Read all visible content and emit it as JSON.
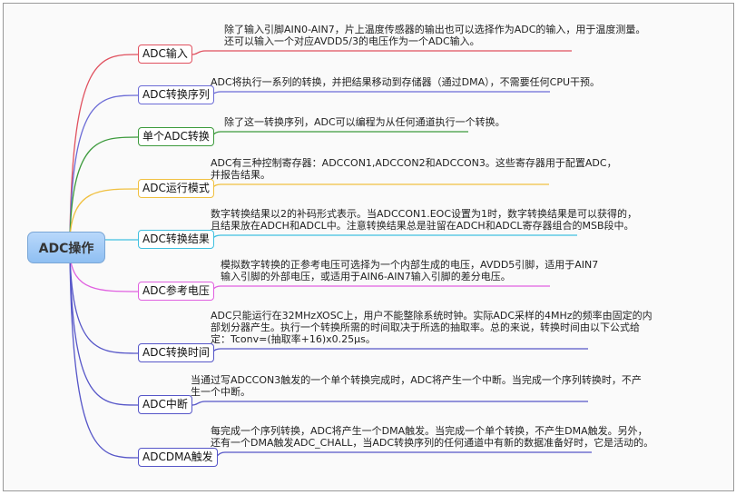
{
  "root": {
    "label": "ADC操作",
    "color": "#9cc8f6"
  },
  "branches": [
    {
      "label": "ADC输入",
      "color": "#e0505e",
      "lines": [
        "除了输入引脚AIN0-AIN7，片上温度传感器的输出也可以选择作为ADC的输入，用于温度测量。",
        "还可以输入一个对应AVDD5/3的电压作为一个ADC输入。"
      ]
    },
    {
      "label": "ADC转换序列",
      "color": "#6b6bd6",
      "lines": [
        "ADC将执行一系列的转换，并把结果移动到存储器（通过DMA），不需要任何CPU干预。"
      ]
    },
    {
      "label": "单个ADC转换",
      "color": "#3c9a3c",
      "lines": [
        "除了这一转换序列，ADC可以编程为从任何通道执行一个转换。"
      ]
    },
    {
      "label": "ADC运行模式",
      "color": "#f0c040",
      "lines": [
        "ADC有三种控制寄存器：ADCCON1,ADCCON2和ADCCON3。这些寄存器用于配置ADC，",
        "并报告结果。"
      ]
    },
    {
      "label": "ADC转换结果",
      "color": "#40c0e0",
      "lines": [
        "数字转换结果以2的补码形式表示。当ADCCON1.EOC设置为1时，数字转换结果是可以获得的，",
        "且结果放在ADCH和ADCL中。注意转换结果总是驻留在ADCH和ADCL寄存器组合的MSB段中。"
      ]
    },
    {
      "label": "ADC参考电压",
      "color": "#e060e0",
      "lines": [
        "模拟数字转换的正参考电压可选择为一个内部生成的电压，AVDD5引脚，适用于AIN7",
        "输入引脚的外部电压，或适用于AIN6-AIN7输入引脚的差分电压。"
      ]
    },
    {
      "label": "ADC转换时间",
      "color": "#5656c8",
      "lines": [
        "ADC只能运行在32MHzXOSC上，用户不能整除系统时钟。实际ADC采样的4MHz的频率由固定的内",
        "部划分器产生。执行一个转换所需的时间取决于所选的抽取率。总的来说，转换时间由以下公式给",
        "定：Tconv=(抽取率+16)x0.25μs。"
      ]
    },
    {
      "label": "ADC中断",
      "color": "#5656c8",
      "lines": [
        "当通过写ADCCON3触发的一个单个转换完成时，ADC将产生一个中断。当完成一个序列转换时，不产",
        "生一个中断。"
      ]
    },
    {
      "label": "ADCDMA触发",
      "color": "#5656c8",
      "lines": [
        "每完成一个序列转换，ADC将产生一个DMA触发。当完成一个单个转换，不产生DMA触发。另外，",
        "还有一个DMA触发ADC_CHALL，当ADC转换序列的任何通道中有新的数据准备好时，它是活动的。"
      ]
    }
  ]
}
